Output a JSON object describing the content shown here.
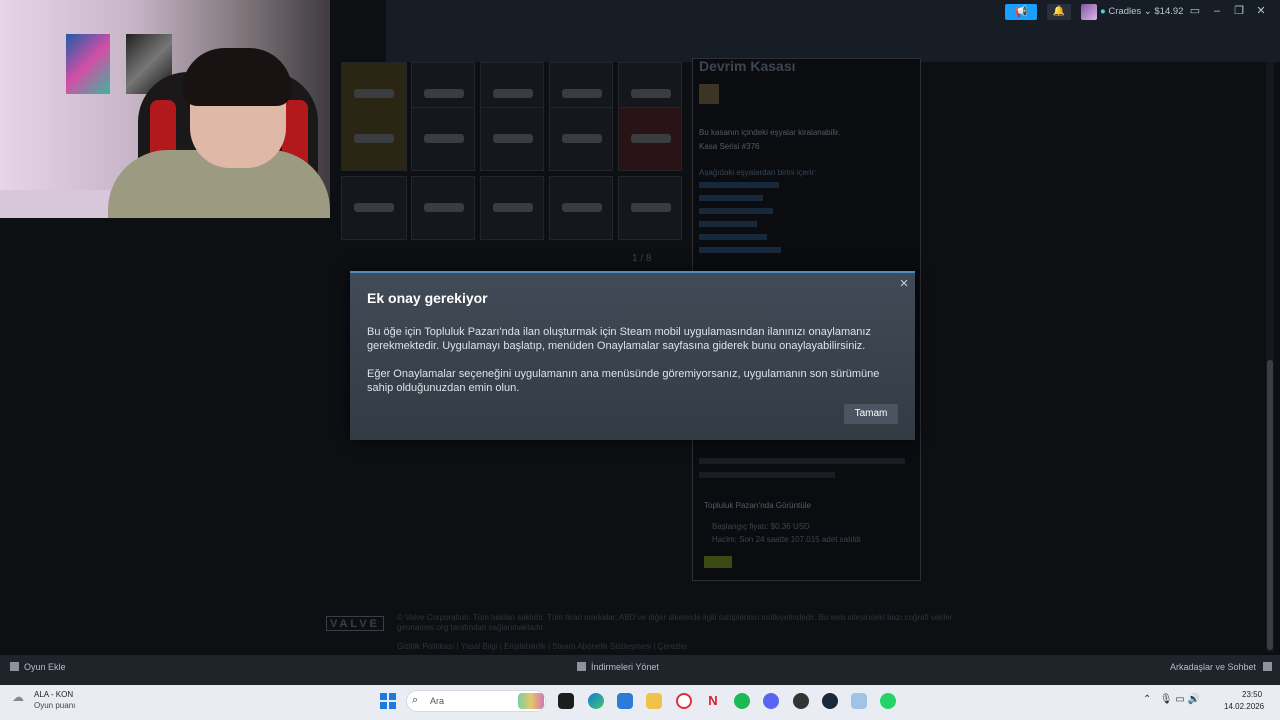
{
  "steam_header": {
    "user_name": "Cradles",
    "wallet": "$14.92",
    "online_dot": "●"
  },
  "steam_page": {
    "case_title": "Devrim Kasası",
    "pager": "1 / 8",
    "lines": [
      "Bu kasanın içindeki eşyalar kiralanabilir.",
      "Kasa Serisi #376",
      "Aşağıdaki eşyalardan birini içerir:",
      "Topluluk Pazarı'nda Görüntüle",
      "Başlangıç fiyatı: $0.36 USD",
      "Hacim: Son 24 saatte 107.015 adet satıldı"
    ]
  },
  "modal": {
    "title": "Ek onay gerekiyor",
    "close_glyph": "×",
    "paragraph1": "Bu öğe için Topluluk Pazarı'nda ilan oluşturmak için Steam mobil uygulamasından ilanınızı onaylamanız gerekmektedir. Uygulamayı başlatıp, menüden Onaylamalar sayfasına giderek bunu onaylayabilirsiniz.",
    "paragraph2": "Eğer Onaylamalar seçeneğini uygulamanın ana menüsünde göremiyorsanız, uygulamanın son sürümüne sahip olduğunuzdan emin olun.",
    "ok_label": "Tamam"
  },
  "footer": {
    "logo": "VALVE",
    "text": "© Valve Corporation. Tüm hakları saklıdır. Tüm ticari markalar, ABD ve diğer ülkelerde ilgili sahiplerinin mülkiyetindedir. Bu web sitesindeki bazı coğrafi veriler geonames.org tarafından sağlanmaktadır.",
    "links": "Gizlilik Politikası  |  Yasal Bilgi  |  Erişilebilirlik  |  Steam Abonelik Sözleşmesi  |  Çerezler"
  },
  "steam_bottom": {
    "add_game": "Oyun Ekle",
    "downloads": "İndirmeleri Yönet",
    "friends": "Arkadaşlar ve Sohbet"
  },
  "taskbar": {
    "weather_line1": "ALA - KON",
    "weather_line2": "Oyun puanı",
    "search_label": "Ara",
    "time": "23:50",
    "date": "14.02.2026"
  }
}
